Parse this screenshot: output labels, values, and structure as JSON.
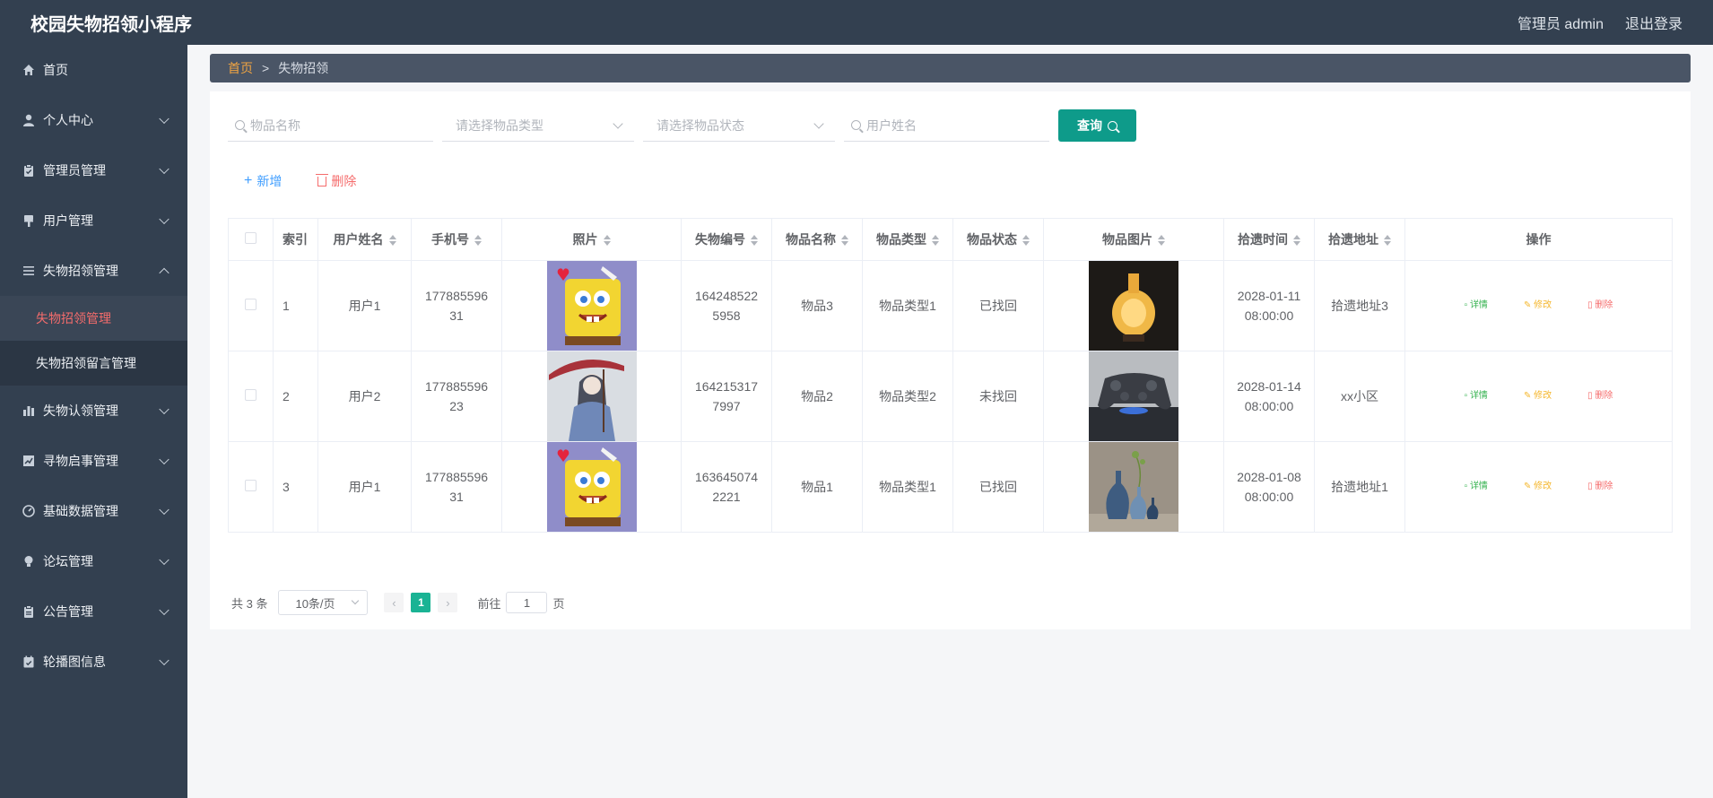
{
  "header": {
    "title": "校园失物招领小程序",
    "user": "管理员 admin",
    "logout": "退出登录"
  },
  "sidebar": {
    "items": [
      {
        "label": "首页",
        "icon": "home-icon"
      },
      {
        "label": "个人中心",
        "icon": "user-icon"
      },
      {
        "label": "管理员管理",
        "icon": "clipboard-icon"
      },
      {
        "label": "用户管理",
        "icon": "brush-icon"
      },
      {
        "label": "失物招领管理",
        "icon": "list-icon"
      },
      {
        "label": "失物认领管理",
        "icon": "bar-chart-icon"
      },
      {
        "label": "寻物启事管理",
        "icon": "trend-icon"
      },
      {
        "label": "基础数据管理",
        "icon": "gauge-icon"
      },
      {
        "label": "论坛管理",
        "icon": "bulb-icon"
      },
      {
        "label": "公告管理",
        "icon": "clipboard-icon"
      },
      {
        "label": "轮播图信息",
        "icon": "calendar-icon"
      }
    ],
    "sub_items": [
      "失物招领管理",
      "失物招领留言管理"
    ]
  },
  "breadcrumb": {
    "home": "首页",
    "sep": ">",
    "current": "失物招领"
  },
  "search": {
    "name_placeholder": "物品名称",
    "type_placeholder": "请选择物品类型",
    "status_placeholder": "请选择物品状态",
    "user_placeholder": "用户姓名",
    "query_label": "查询"
  },
  "actions": {
    "add": "新增",
    "delete": "删除"
  },
  "table": {
    "headers": [
      "索引",
      "用户姓名",
      "手机号",
      "照片",
      "失物编号",
      "物品名称",
      "物品类型",
      "物品状态",
      "物品图片",
      "拾遗时间",
      "拾遗地址",
      "操作"
    ],
    "rows": [
      {
        "index": "1",
        "user": "用户1",
        "phone_a": "177885596",
        "phone_b": "31",
        "photo": "spongebob",
        "code_a": "164248522",
        "code_b": "5958",
        "name": "物品3",
        "type": "物品类型1",
        "status": "已找回",
        "pic": "lamp",
        "time_a": "2028-01-11",
        "time_b": "08:00:00",
        "address": "拾遗地址3"
      },
      {
        "index": "2",
        "user": "用户2",
        "phone_a": "177885596",
        "phone_b": "23",
        "photo": "umbrella-girl",
        "code_a": "164215317",
        "code_b": "7997",
        "name": "物品2",
        "type": "物品类型2",
        "status": "未找回",
        "pic": "gamepad",
        "time_a": "2028-01-14",
        "time_b": "08:00:00",
        "address": "xx小区"
      },
      {
        "index": "3",
        "user": "用户1",
        "phone_a": "177885596",
        "phone_b": "31",
        "photo": "spongebob",
        "code_a": "163645074",
        "code_b": "2221",
        "name": "物品1",
        "type": "物品类型1",
        "status": "已找回",
        "pic": "vases",
        "time_a": "2028-01-08",
        "time_b": "08:00:00",
        "address": "拾遗地址1"
      }
    ],
    "op_detail": "详情",
    "op_edit": "修改",
    "op_delete": "删除"
  },
  "pagination": {
    "total": "共 3 条",
    "page_size": "10条/页",
    "current": "1",
    "goto_label": "前往",
    "goto_value": "1",
    "page_unit": "页"
  },
  "colors": {
    "sidebar": "#334050",
    "accent": "#0e9b8a",
    "active": "#f56c6c"
  }
}
